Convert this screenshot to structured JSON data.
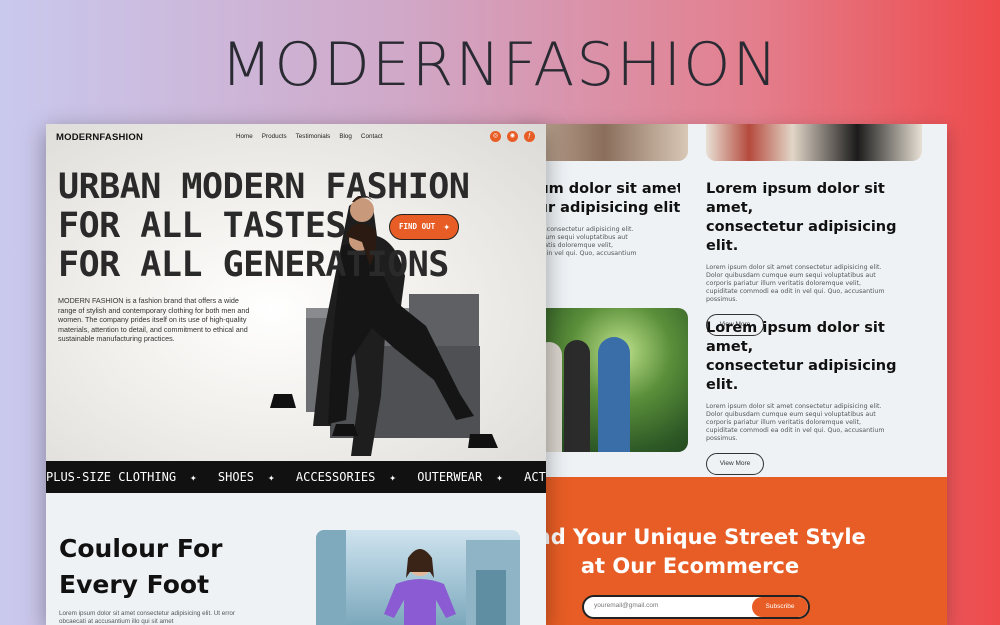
{
  "banner": {
    "title": "MODERNFASHION"
  },
  "nav": {
    "logo": "MODERNFASHION",
    "links": [
      "Home",
      "Products",
      "Testimonials",
      "Blog",
      "Contact"
    ],
    "icons": [
      "instagram-icon",
      "dribbble-icon",
      "facebook-icon"
    ]
  },
  "hero": {
    "title_lines": [
      "URBAN MODERN FASHION",
      "FOR ALL TASTES",
      "FOR ALL GENERATIONS"
    ],
    "description": "MODERN FASHION is a fashion brand that offers a wide range of stylish and contemporary clothing for both men and women. The company prides itself on its use of high-quality materials, attention to detail, and commitment to ethical and sustainable manufacturing practices.",
    "cta": "FIND OUT"
  },
  "ticker": {
    "items": [
      "PLUS-SIZE CLOTHING",
      "SHOES",
      "ACCESSORIES",
      "OUTERWEAR",
      "ACTIVEW"
    ]
  },
  "section2": {
    "title_lines": [
      "Coulour For",
      "Every Foot"
    ],
    "text": "Lorem ipsum dolor sit amet consectetur adipisicing elit. Ut error obcaecati at accusantium illo qui sit amet"
  },
  "blog": {
    "articles": [
      {
        "title_lines": [
          "Lorem ipsum dolor sit amet,",
          "consectetur adipisicing elit."
        ],
        "body": "Lorem ipsum dolor sit amet consectetur adipisicing elit. Dolor quibusdam cumque eum sequi voluptatibus aut corporis pariatur illum veritatis doloremque velit, cupiditate commodi ea odit in vel qui. Quo, accusantium possimus.",
        "button": "View More"
      },
      {
        "title_lines": [
          "Lorem ipsum dolor sit amet,",
          "consectetur adipisicing elit."
        ],
        "body": "Lorem ipsum dolor sit amet consectetur adipisicing elit. Dolor quibusdam cumque eum sequi voluptatibus aut corporis pariatur illum veritatis doloremque velit, cupiditate commodi ea odit in vel qui. Quo, accusantium possimus.",
        "button": "View More"
      }
    ],
    "left_articles": [
      {
        "title_lines": [
          "Lorem ipsum dolor sit amet,",
          "consectetur adipisicing elit."
        ],
        "body": "Lorem ipsum dolor sit amet consectetur adipisicing elit. Dolor quibusdam cumque eum sequi voluptatibus aut corporis pariatur illum veritatis doloremque velit, cupiditate commodi ea odit in vel qui. Quo, accusantium"
      }
    ]
  },
  "subscribe": {
    "title_lines": [
      "Find Your Unique Street Style",
      "at Our Ecommerce"
    ],
    "placeholder": "youremail@gmail.com",
    "button": "Subscribe"
  },
  "colors": {
    "accent": "#e85d25",
    "dark": "#111111",
    "light_bg": "#eef2f5"
  }
}
